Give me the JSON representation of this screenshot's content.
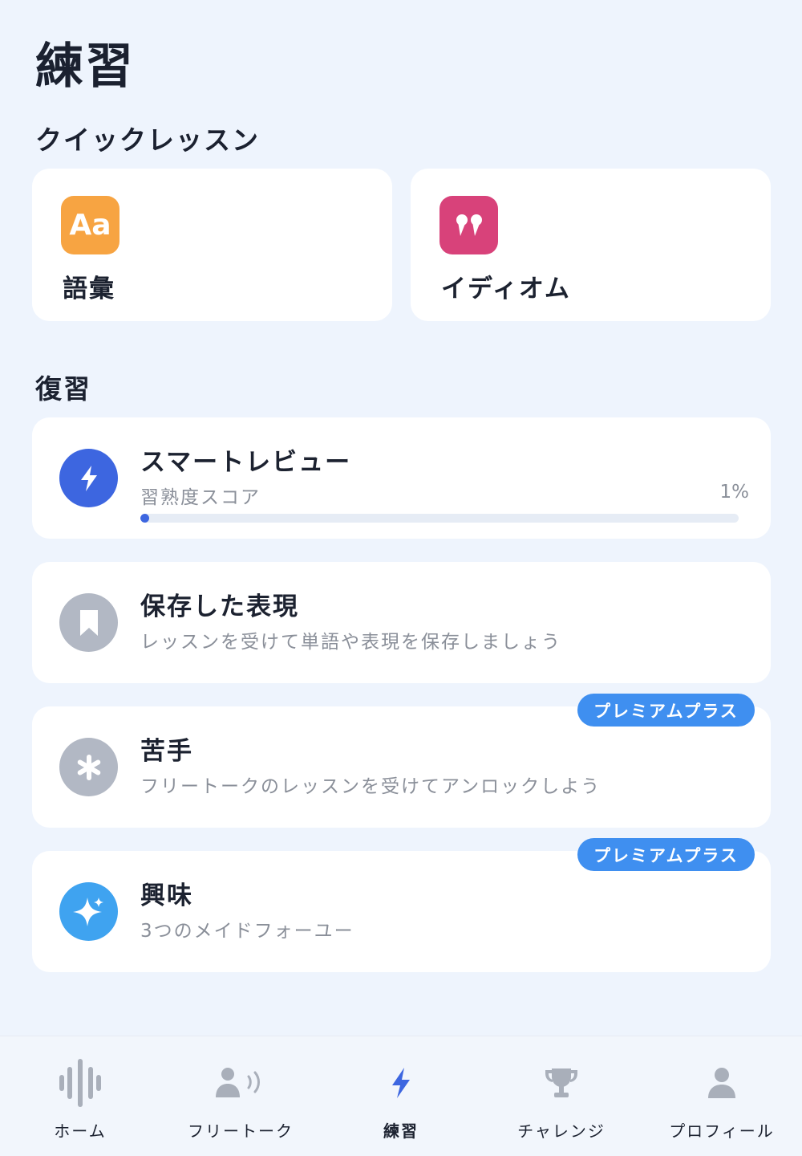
{
  "page": {
    "title": "練習"
  },
  "quick_lessons": {
    "title": "クイックレッスン",
    "items": [
      {
        "label": "語彙",
        "icon": "aa-icon",
        "icon_text": "Aa",
        "color": "#f7a442"
      },
      {
        "label": "イディオム",
        "icon": "quote-icon",
        "color": "#d8427a"
      }
    ]
  },
  "review": {
    "title": "復習",
    "smart_review": {
      "title": "スマートレビュー",
      "subtitle": "習熟度スコア",
      "percent_label": "1%",
      "progress": 0.01,
      "icon": "lightning-icon",
      "color": "#3d66e0"
    },
    "saved": {
      "title": "保存した表現",
      "subtitle": "レッスンを受けて単語や表現を保存しましょう",
      "icon": "bookmark-icon",
      "color": "#b2b8c4"
    },
    "weak": {
      "title": "苦手",
      "subtitle": "フリートークのレッスンを受けてアンロックしよう",
      "badge": "プレミアムプラス",
      "icon": "asterisk-icon",
      "color": "#b2b8c4"
    },
    "interest": {
      "title": "興味",
      "subtitle": "3つのメイドフォーユー",
      "badge": "プレミアムプラス",
      "icon": "sparkle-icon",
      "color": "#3fa3f0"
    }
  },
  "nav": {
    "items": [
      {
        "label": "ホーム",
        "icon": "waveform-icon",
        "active": false
      },
      {
        "label": "フリートーク",
        "icon": "person-talking-icon",
        "active": false
      },
      {
        "label": "練習",
        "icon": "lightning-icon",
        "active": true
      },
      {
        "label": "チャレンジ",
        "icon": "trophy-icon",
        "active": false
      },
      {
        "label": "プロフィール",
        "icon": "person-icon",
        "active": false
      }
    ]
  },
  "colors": {
    "accent": "#3d66e0",
    "badge": "#3f8ff0",
    "background": "#eef4fd",
    "inactive_icon": "#a9afba"
  }
}
